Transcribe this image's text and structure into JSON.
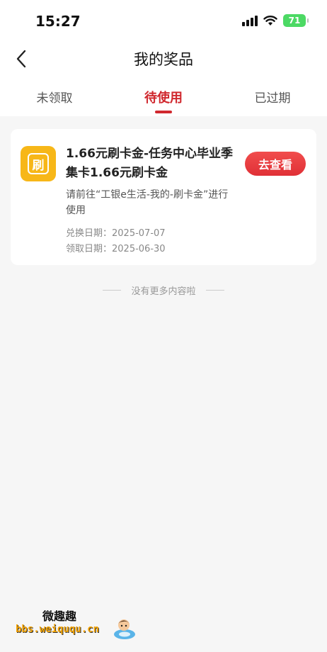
{
  "status_bar": {
    "time": "15:27",
    "battery": "71"
  },
  "header": {
    "title": "我的奖品"
  },
  "tabs": [
    {
      "label": "未领取",
      "active": false
    },
    {
      "label": "待使用",
      "active": true
    },
    {
      "label": "已过期",
      "active": false
    }
  ],
  "prize": {
    "icon_char": "刷",
    "title": "1.66元刷卡金-任务中心毕业季集卡1.66元刷卡金",
    "description": "请前往“工银e生活-我的-刷卡金”进行使用",
    "exchange_date_label": "兑换日期：",
    "exchange_date": "2025-07-07",
    "receive_date_label": "领取日期：",
    "receive_date": "2025-06-30",
    "action_label": "去查看"
  },
  "end_text": "没有更多内容啦",
  "watermark": {
    "title": "微趣趣",
    "url": "bbs.weiququ.cn"
  },
  "colors": {
    "accent": "#d0282e",
    "icon_bg": "#f7b718",
    "battery": "#4cd964"
  }
}
